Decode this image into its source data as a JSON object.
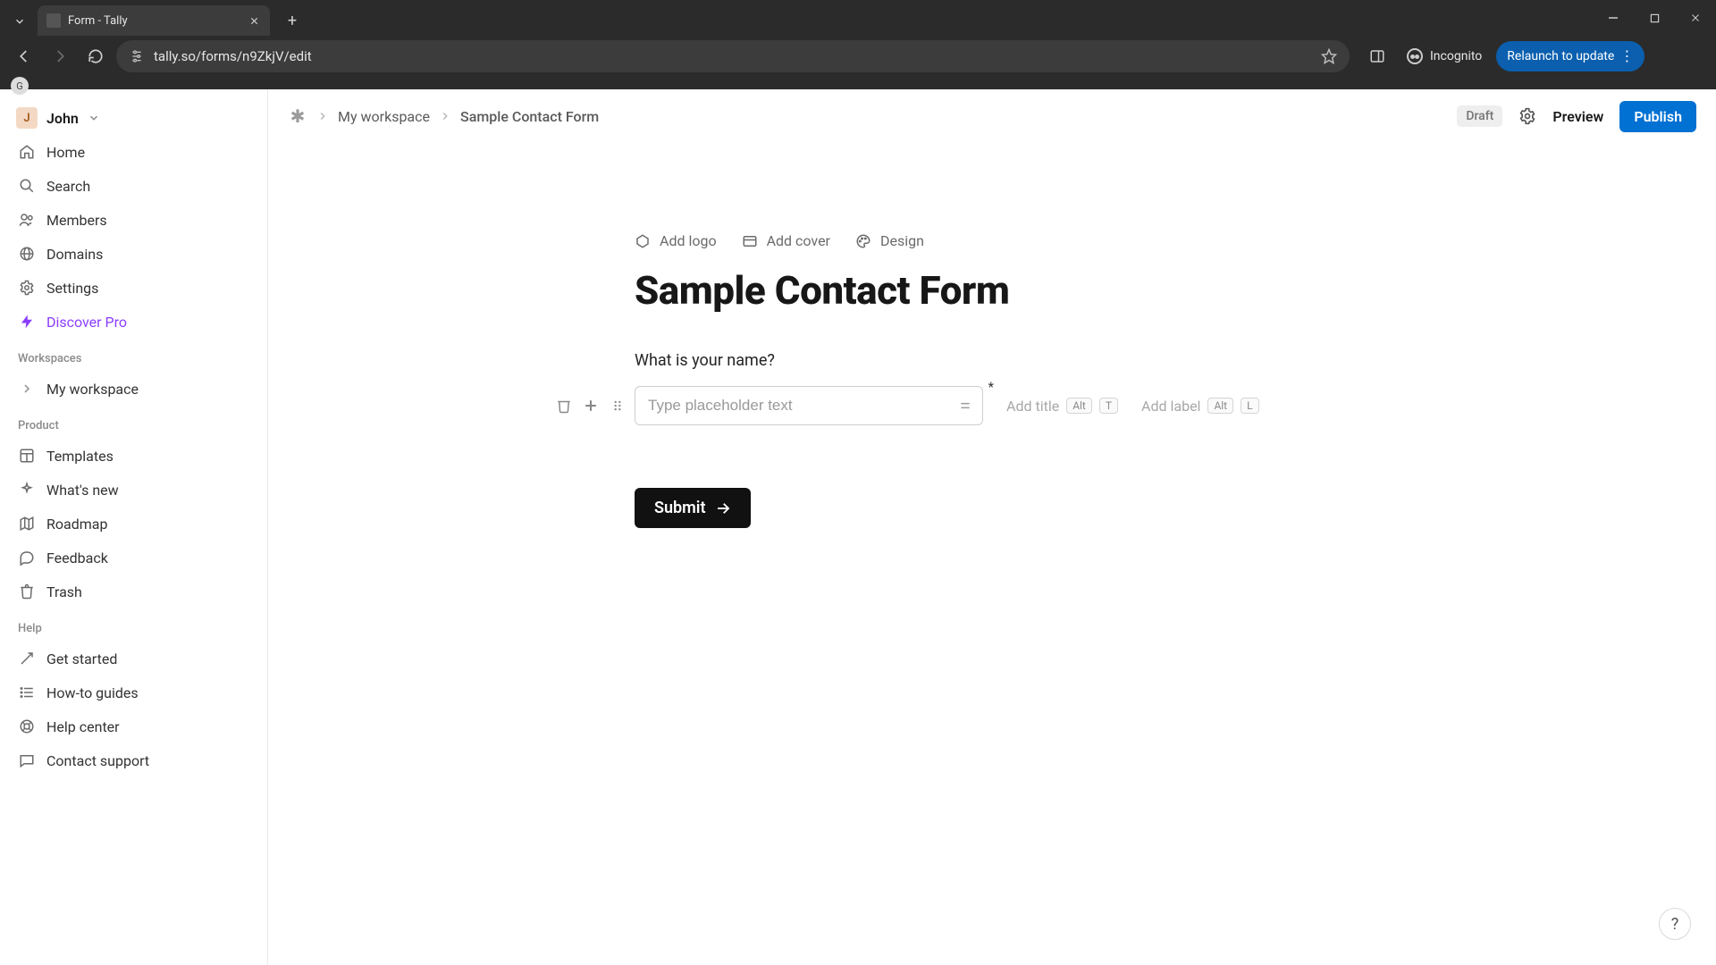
{
  "browser": {
    "tab_title": "Form - Tally",
    "url": "tally.so/forms/n9ZkjV/edit",
    "incognito_label": "Incognito",
    "relaunch_label": "Relaunch to update"
  },
  "sidebar": {
    "user": {
      "initial": "J",
      "name": "John"
    },
    "nav": {
      "home": "Home",
      "search": "Search",
      "members": "Members",
      "domains": "Domains",
      "settings": "Settings",
      "discover_pro": "Discover Pro"
    },
    "sections": {
      "workspaces_header": "Workspaces",
      "my_workspace": "My workspace",
      "product_header": "Product",
      "templates": "Templates",
      "whats_new": "What's new",
      "roadmap": "Roadmap",
      "feedback": "Feedback",
      "trash": "Trash",
      "help_header": "Help",
      "get_started": "Get started",
      "howto": "How-to guides",
      "help_center": "Help center",
      "contact": "Contact support"
    }
  },
  "topbar": {
    "crumb_workspace": "My workspace",
    "crumb_form": "Sample Contact Form",
    "draft_badge": "Draft",
    "preview": "Preview",
    "publish": "Publish"
  },
  "editor": {
    "meta": {
      "add_logo": "Add logo",
      "add_cover": "Add cover",
      "design": "Design"
    },
    "form_title": "Sample Contact Form",
    "question_label": "What is your name?",
    "input_placeholder": "Type placeholder text",
    "add_title": "Add title",
    "add_label": "Add label",
    "kbd_alt": "Alt",
    "kbd_t": "T",
    "kbd_l": "L",
    "submit": "Submit"
  }
}
